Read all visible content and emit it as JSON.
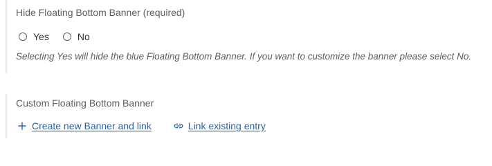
{
  "hide_banner": {
    "label": "Hide Floating Bottom Banner (required)",
    "options": [
      {
        "label": "Yes",
        "selected": false
      },
      {
        "label": "No",
        "selected": false
      }
    ],
    "help_text": "Selecting Yes will hide the blue Floating Bottom Banner. If you want to customize the banner please select No."
  },
  "custom_banner": {
    "label": "Custom Floating Bottom Banner",
    "create_link": {
      "label": "Create new Banner and link",
      "icon": "plus-icon"
    },
    "existing_link": {
      "label": "Link existing entry",
      "icon": "link-icon"
    }
  },
  "colors": {
    "link": "#2b62a6",
    "border": "#e3e6ea",
    "muted_text": "#5b5f64"
  }
}
